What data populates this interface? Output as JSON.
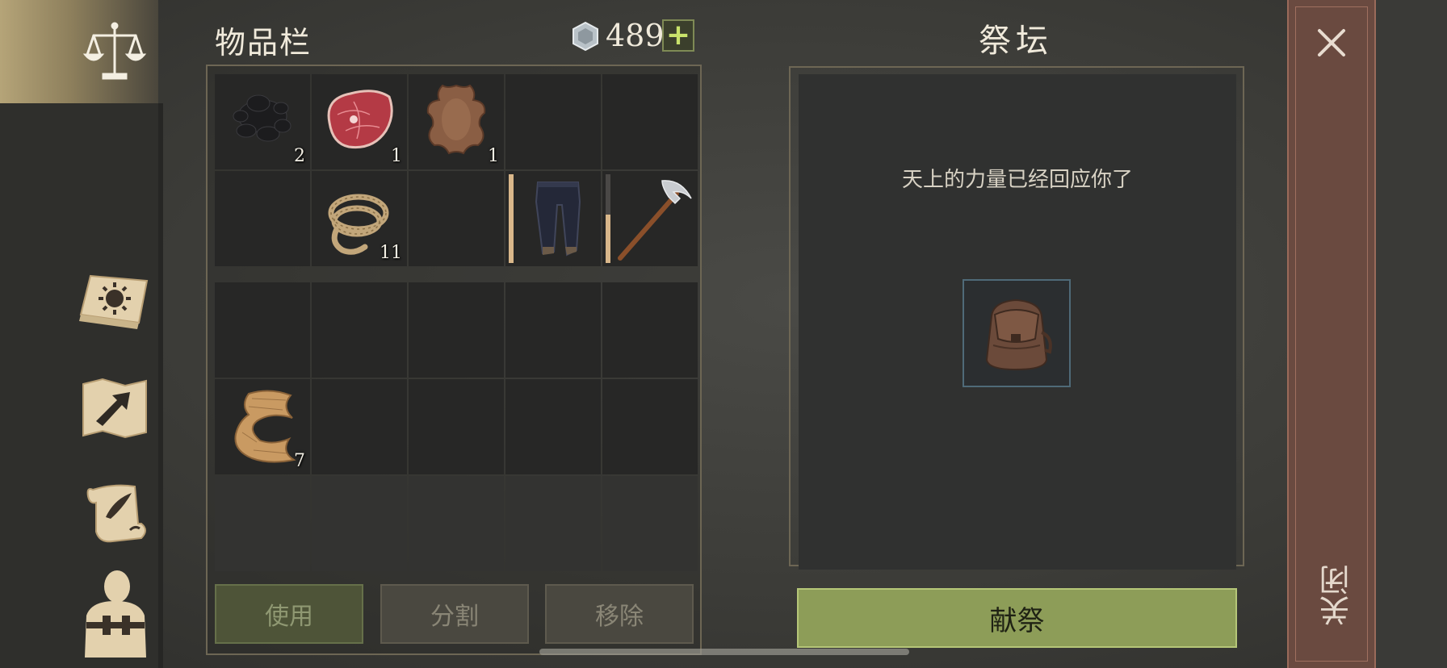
{
  "inventory": {
    "title": "物品栏",
    "currency": 489,
    "add_currency_label": "+",
    "grid_rows": [
      [
        {
          "item": "coal-icon",
          "count": "2"
        },
        {
          "item": "meat-icon",
          "count": "1"
        },
        {
          "item": "hide-icon",
          "count": "1"
        },
        {
          "item": "",
          "count": ""
        },
        {
          "item": "",
          "count": ""
        }
      ],
      [
        {
          "item": "",
          "count": ""
        },
        {
          "item": "rope-icon",
          "count": "11"
        },
        {
          "item": "",
          "count": ""
        },
        {
          "item": "pants-icon",
          "count": "",
          "durability": 1.0
        },
        {
          "item": "pickaxe-icon",
          "count": "",
          "durability": 0.55
        }
      ],
      [
        {
          "item": "",
          "count": ""
        },
        {
          "item": "",
          "count": ""
        },
        {
          "item": "",
          "count": ""
        },
        {
          "item": "",
          "count": ""
        },
        {
          "item": "",
          "count": ""
        }
      ],
      [
        {
          "item": "cloth-icon",
          "count": "7"
        },
        {
          "item": "",
          "count": ""
        },
        {
          "item": "",
          "count": ""
        },
        {
          "item": "",
          "count": ""
        },
        {
          "item": "",
          "count": ""
        }
      ]
    ],
    "locked_row_slots": 5,
    "buttons": {
      "use": "使用",
      "split": "分割",
      "remove": "移除"
    }
  },
  "altar": {
    "title": "祭坛",
    "message": "天上的力量已经回应你了",
    "offered_item": "backpack-icon",
    "offer_button": "献祭"
  },
  "close_label": "关闭",
  "sidebar": [
    "scales-icon",
    "sun-book-icon",
    "map-icon",
    "scroll-icon",
    "character-icon"
  ],
  "colors": {
    "accent_green": "#8d9d58",
    "close_red": "#6a4a40"
  }
}
